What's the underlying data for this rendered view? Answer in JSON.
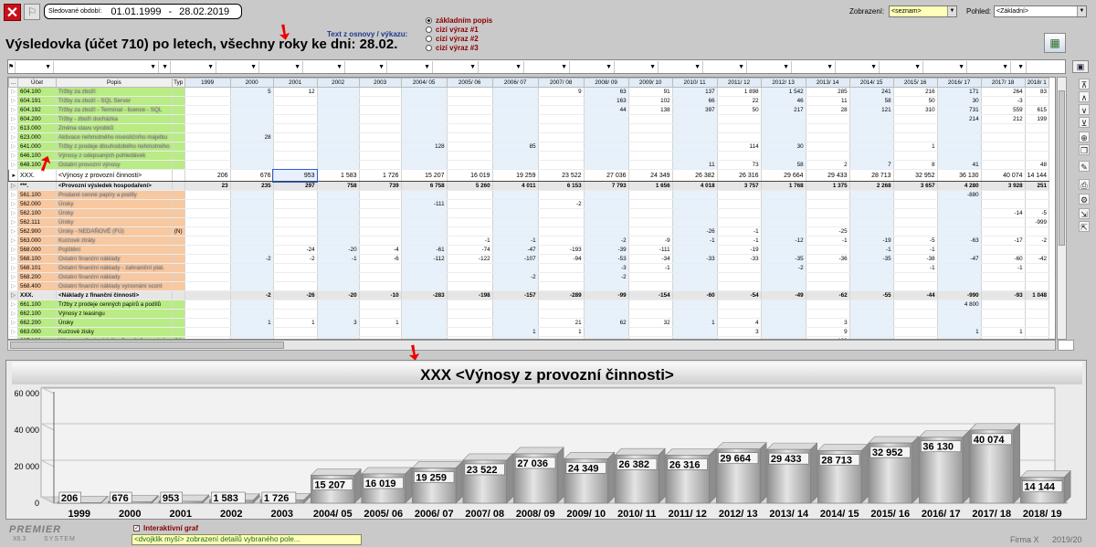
{
  "toolbar": {
    "close_glyph": "✕",
    "flag_glyph": "⚐"
  },
  "period": {
    "label": "Sledované období:",
    "from": "01.01.1999",
    "dash": "-",
    "to": "28.02.2019"
  },
  "source_text": {
    "label": "Text z osnovy / výkazu:",
    "options": [
      "základním popis",
      "cizí výraz #1",
      "cizí výraz #2",
      "cizí výraz #3"
    ],
    "selected_index": 0
  },
  "display": {
    "zobrazeni_label": "Zobrazení:",
    "zobrazeni_value": "<seznam>",
    "pohled_label": "Pohled:",
    "pohled_value": "<Základní>"
  },
  "title": "Výsledovka (účet 710) po letech, všechny roky ke dni: 28.02.",
  "grid": {
    "headers": [
      "...",
      "Účet",
      "Popis",
      "Typ",
      "1999",
      "2000",
      "2001",
      "2002",
      "2003",
      "2004/ 05",
      "2005/ 06",
      "2006/ 07",
      "2007/ 08",
      "2008/ 09",
      "2009/ 10",
      "2010/ 11",
      "2011/ 12",
      "2012/ 13",
      "2013/ 14",
      "2014/ 15",
      "2015/ 16",
      "2016/ 17",
      "2017/ 18",
      "2018/ 1"
    ],
    "rows": [
      {
        "c": "g",
        "b": 1,
        "acc": "604.100",
        "desc": "Tržby za zboží",
        "typ": "",
        "v": [
          "",
          "5",
          "12",
          "",
          "",
          "",
          "",
          "",
          "9",
          "63",
          "91",
          "137",
          "1 898",
          "1 542",
          "285",
          "241",
          "216",
          "171",
          "264",
          "83"
        ]
      },
      {
        "c": "g",
        "b": 1,
        "acc": "604.191",
        "desc": "Tržby za zboží - SQL Server",
        "typ": "",
        "v": [
          "",
          "",
          "",
          "",
          "",
          "",
          "",
          "",
          "",
          "163",
          "102",
          "66",
          "22",
          "46",
          "11",
          "58",
          "50",
          "30",
          "-3",
          ""
        ]
      },
      {
        "c": "g",
        "b": 1,
        "acc": "604.192",
        "desc": "Tržby za zboží - Terminal - licence - SQL",
        "typ": "",
        "v": [
          "",
          "",
          "",
          "",
          "",
          "",
          "",
          "",
          "",
          "44",
          "138",
          "397",
          "50",
          "217",
          "28",
          "121",
          "310",
          "731",
          "559",
          "615"
        ]
      },
      {
        "c": "g",
        "b": 1,
        "acc": "604.200",
        "desc": "Tržby - zboží docházka",
        "typ": "",
        "v": [
          "",
          "",
          "",
          "",
          "",
          "",
          "",
          "",
          "",
          "",
          "",
          "",
          "",
          "",
          "",
          "",
          "",
          "214",
          "212",
          "199"
        ]
      },
      {
        "c": "g",
        "b": 1,
        "acc": "613.000",
        "desc": "Změna stavu výrobků",
        "typ": "",
        "v": [
          "",
          "",
          "",
          "",
          "",
          "",
          "",
          "",
          "",
          "",
          "",
          "",
          "",
          "",
          "",
          "",
          "",
          "",
          "",
          ""
        ]
      },
      {
        "c": "g",
        "b": 1,
        "acc": "623.000",
        "desc": "Aktivace nehmotného investičního majetku",
        "typ": "",
        "v": [
          "",
          "28",
          "",
          "",
          "",
          "",
          "",
          "",
          "",
          "",
          "",
          "",
          "",
          "",
          "",
          "",
          "",
          "",
          "",
          ""
        ]
      },
      {
        "c": "g",
        "b": 1,
        "acc": "641.000",
        "desc": "Tržby z prodeje dlouhodobého nehmotného",
        "typ": "",
        "v": [
          "",
          "",
          "",
          "",
          "",
          "128",
          "",
          "85",
          "",
          "",
          "",
          "",
          "114",
          "30",
          "",
          "",
          "1",
          "",
          "",
          ""
        ]
      },
      {
        "c": "g",
        "b": 1,
        "acc": "646.100",
        "desc": "Výnosy z odepsaných pohledávek",
        "typ": "",
        "v": [
          "",
          "",
          "",
          "",
          "",
          "",
          "",
          "",
          "",
          "",
          "",
          "",
          "",
          "",
          "",
          "",
          "",
          "",
          "",
          ""
        ]
      },
      {
        "c": "g",
        "b": 1,
        "acc": "648.100",
        "desc": "Ostatní provozní výnosy",
        "typ": "",
        "v": [
          "",
          "",
          "",
          "",
          "",
          "",
          "",
          "",
          "",
          "",
          "",
          "11",
          "73",
          "58",
          "2",
          "7",
          "8",
          "41",
          "",
          "48"
        ]
      },
      {
        "c": "sel",
        "b": 0,
        "acc": "XXX.",
        "desc": "<Výnosy z provozní činnosti>",
        "typ": "",
        "v": [
          "206",
          "676",
          "953",
          "1 583",
          "1 726",
          "15 207",
          "16 019",
          "19 259",
          "23 522",
          "27 036",
          "24 349",
          "26 382",
          "26 316",
          "29 664",
          "29 433",
          "28 713",
          "32 952",
          "36 130",
          "40 074",
          "14 144"
        ]
      },
      {
        "c": "sum",
        "b": 0,
        "acc": "***.",
        "desc": "<Provozní výsledek hospodaření>",
        "typ": "",
        "v": [
          "23",
          "235",
          "297",
          "758",
          "739",
          "6 758",
          "5 260",
          "4 011",
          "6 153",
          "7 793",
          "1 656",
          "4 018",
          "3 757",
          "1 768",
          "1 375",
          "2 268",
          "3 657",
          "4 280",
          "3 928",
          "251"
        ]
      },
      {
        "c": "o",
        "b": 1,
        "acc": "561.100",
        "desc": "Prodané cenné papíry a podíly",
        "typ": "",
        "v": [
          "",
          "",
          "",
          "",
          "",
          "",
          "",
          "",
          "",
          "",
          "",
          "",
          "",
          "",
          "",
          "",
          "",
          "-880",
          "",
          ""
        ]
      },
      {
        "c": "o",
        "b": 1,
        "acc": "562.000",
        "desc": "Úroky",
        "typ": "",
        "v": [
          "",
          "",
          "",
          "",
          "",
          "-111",
          "",
          "",
          "-2",
          "",
          "",
          "",
          "",
          "",
          "",
          "",
          "",
          "",
          "",
          ""
        ]
      },
      {
        "c": "o",
        "b": 1,
        "acc": "562.100",
        "desc": "Úroky",
        "typ": "",
        "v": [
          "",
          "",
          "",
          "",
          "",
          "",
          "",
          "",
          "",
          "",
          "",
          "",
          "",
          "",
          "",
          "",
          "",
          "",
          "-14",
          "-5"
        ]
      },
      {
        "c": "o",
        "b": 1,
        "acc": "562.111",
        "desc": "Úroky",
        "typ": "",
        "v": [
          "",
          "",
          "",
          "",
          "",
          "",
          "",
          "",
          "",
          "",
          "",
          "",
          "",
          "",
          "",
          "",
          "",
          "",
          "",
          "-999"
        ]
      },
      {
        "c": "o",
        "b": 1,
        "acc": "562.900",
        "desc": "Úroky - NEDAŇOVÉ (FÚ)",
        "typ": "(N)",
        "v": [
          "",
          "",
          "",
          "",
          "",
          "",
          "",
          "",
          "",
          "",
          "",
          "-26",
          "-1",
          "",
          "-25",
          "",
          "",
          "",
          "",
          ""
        ]
      },
      {
        "c": "o",
        "b": 1,
        "acc": "563.000",
        "desc": "Kurzové ztráty",
        "typ": "",
        "v": [
          "",
          "",
          "",
          "",
          "",
          "",
          "-1",
          "-1",
          "",
          "-2",
          "-9",
          "-1",
          "-1",
          "-12",
          "-1",
          "-19",
          "-5",
          "-63",
          "-17",
          "-2"
        ]
      },
      {
        "c": "o",
        "b": 1,
        "acc": "568.000",
        "desc": "Pojištění",
        "typ": "",
        "v": [
          "",
          "",
          "-24",
          "-20",
          "-4",
          "-61",
          "-74",
          "-47",
          "-193",
          "-39",
          "-111",
          "",
          "-19",
          "",
          "",
          "-1",
          "-1",
          "",
          "",
          ""
        ]
      },
      {
        "c": "o",
        "b": 1,
        "acc": "568.100",
        "desc": "Ostatní finanční náklady",
        "typ": "",
        "v": [
          "",
          "-2",
          "-2",
          "-1",
          "-6",
          "-112",
          "-122",
          "-107",
          "-94",
          "-53",
          "-34",
          "-33",
          "-33",
          "-35",
          "-36",
          "-35",
          "-38",
          "-47",
          "-60",
          "-42"
        ]
      },
      {
        "c": "o",
        "b": 1,
        "acc": "568.101",
        "desc": "Ostatní finanční náklady - zahraniční plat.",
        "typ": "",
        "v": [
          "",
          "",
          "",
          "",
          "",
          "",
          "",
          "",
          "",
          "-3",
          "-1",
          "",
          "",
          "-2",
          "",
          "",
          "-1",
          "",
          "-1",
          ""
        ]
      },
      {
        "c": "o",
        "b": 1,
        "acc": "568.200",
        "desc": "Ostatní finanční náklady",
        "typ": "",
        "v": [
          "",
          "",
          "",
          "",
          "",
          "",
          "",
          "-2",
          "",
          "-2",
          "",
          "",
          "",
          "",
          "",
          "",
          "",
          "",
          "",
          ""
        ]
      },
      {
        "c": "o",
        "b": 1,
        "acc": "568.400",
        "desc": "Ostatní finanční náklady vyrovnání scont",
        "typ": "",
        "v": [
          "",
          "",
          "",
          "",
          "",
          "",
          "",
          "",
          "",
          "",
          "",
          "",
          "",
          "",
          "",
          "",
          "",
          "",
          "",
          ""
        ]
      },
      {
        "c": "sum2",
        "b": 0,
        "acc": "XXX.",
        "desc": "<Náklady z finanční činnosti>",
        "typ": "",
        "v": [
          "",
          "-2",
          "-26",
          "-20",
          "-10",
          "-283",
          "-198",
          "-157",
          "-289",
          "-99",
          "-154",
          "-60",
          "-54",
          "-49",
          "-62",
          "-55",
          "-44",
          "-990",
          "-93",
          "1 048"
        ]
      },
      {
        "c": "g",
        "b": 0,
        "acc": "661.100",
        "desc": "Tržby z prodeje cenných papírů a podílů",
        "typ": "",
        "v": [
          "",
          "",
          "",
          "",
          "",
          "",
          "",
          "",
          "",
          "",
          "",
          "",
          "",
          "",
          "",
          "",
          "",
          "4 800",
          "",
          ""
        ]
      },
      {
        "c": "g",
        "b": 0,
        "acc": "662.100",
        "desc": "Výnosy z leasingu",
        "typ": "",
        "v": [
          "",
          "",
          "",
          "",
          "",
          "",
          "",
          "",
          "",
          "",
          "",
          "",
          "",
          "",
          "",
          "",
          "",
          "",
          "",
          ""
        ]
      },
      {
        "c": "g",
        "b": 0,
        "acc": "662.200",
        "desc": "Úroky",
        "typ": "",
        "v": [
          "",
          "1",
          "1",
          "3",
          "1",
          "",
          "",
          "",
          "21",
          "62",
          "32",
          "1",
          "4",
          "",
          "3",
          "",
          "",
          "",
          "",
          ""
        ]
      },
      {
        "c": "g",
        "b": 0,
        "acc": "663.000",
        "desc": "Kurzové zisky",
        "typ": "",
        "v": [
          "",
          "",
          "",
          "",
          "",
          "",
          "",
          "1",
          "1",
          "",
          "",
          "",
          "3",
          "",
          "9",
          "",
          "",
          "1",
          "1",
          ""
        ]
      },
      {
        "c": "g",
        "b": 0,
        "acc": "665.100",
        "desc": "Výnosy z dlouhodobého finančního majetku",
        "typ": "(N)",
        "v": [
          "",
          "",
          "",
          "",
          "",
          "",
          "",
          "",
          "",
          "",
          "",
          "",
          "",
          "",
          "128",
          "",
          "",
          "",
          "",
          ""
        ]
      }
    ]
  },
  "chart_data": {
    "type": "bar",
    "title": "XXX <Výnosy z provozní činnosti>",
    "categories": [
      "1999",
      "2000",
      "2001",
      "2002",
      "2003",
      "2004/ 05",
      "2005/ 06",
      "2006/ 07",
      "2007/ 08",
      "2008/ 09",
      "2009/ 10",
      "2010/ 11",
      "2011/ 12",
      "2012/ 13",
      "2013/ 14",
      "2014/ 15",
      "2015/ 16",
      "2016/ 17",
      "2017/ 18",
      "2018/ 19"
    ],
    "values": [
      206,
      676,
      953,
      1583,
      1726,
      15207,
      16019,
      19259,
      23522,
      27036,
      24349,
      26382,
      26316,
      29664,
      29433,
      28713,
      32952,
      36130,
      40074,
      14144
    ],
    "labels": [
      "206",
      "676",
      "953",
      "1 583",
      "1 726",
      "15 207",
      "16 019",
      "19 259",
      "23 522",
      "27 036",
      "24 349",
      "26 382",
      "26 316",
      "29 664",
      "29 433",
      "28 713",
      "32 952",
      "36 130",
      "40 074",
      "14 144"
    ],
    "yticks": [
      0,
      20000,
      40000,
      60000
    ],
    "ytick_labels": [
      "0",
      "20 000",
      "40 000",
      "60 000"
    ],
    "ylim": [
      0,
      60000
    ],
    "grid": true,
    "bar_color": "#bdbdbd"
  },
  "footer": {
    "brand_top": "PREMIER",
    "brand_version": "X6.3",
    "brand_bottom": "SYSTEM",
    "interactive_label": "Interaktivní graf",
    "hint": "<dvojklik myší> zobrazení detailů vybraného pole...",
    "company": "Firma X",
    "year": "2019/20"
  }
}
